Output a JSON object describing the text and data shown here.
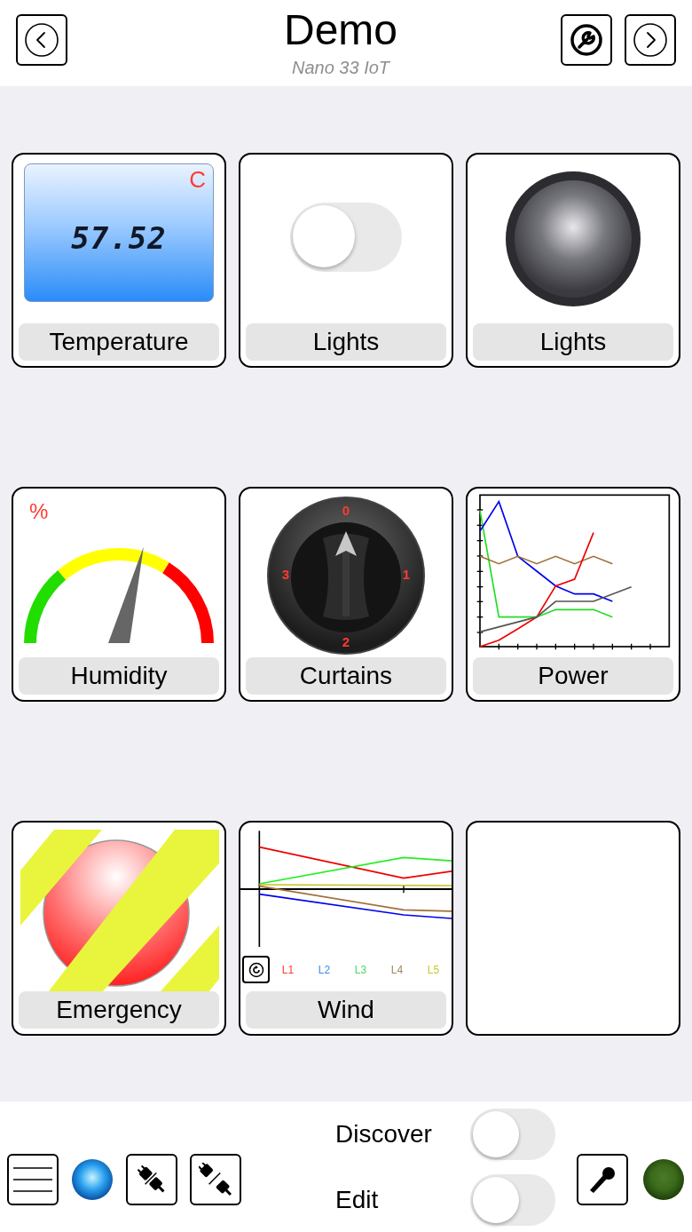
{
  "header": {
    "title": "Demo",
    "subtitle": "Nano 33 IoT"
  },
  "tiles": [
    {
      "kind": "temperature",
      "label": "Temperature",
      "value": "57.52",
      "unit": "C"
    },
    {
      "kind": "switch",
      "label": "Lights",
      "on": false
    },
    {
      "kind": "led",
      "label": "Lights",
      "on": false
    },
    {
      "kind": "gauge",
      "label": "Humidity",
      "unit": "%",
      "level": 0.58
    },
    {
      "kind": "knob",
      "label": "Curtains",
      "marks": [
        "0",
        "1",
        "2",
        "3"
      ]
    },
    {
      "kind": "plot",
      "label": "Power"
    },
    {
      "kind": "button",
      "label": "Emergency"
    },
    {
      "kind": "graph",
      "label": "Wind",
      "legend": [
        {
          "text": "L1",
          "color": "#ff3b30"
        },
        {
          "text": "L2",
          "color": "#3b8ee8"
        },
        {
          "text": "L3",
          "color": "#4cd964"
        },
        {
          "text": "L4",
          "color": "#a2845e"
        },
        {
          "text": "L5",
          "color": "#c7c72a"
        }
      ]
    },
    {
      "kind": "empty"
    }
  ],
  "toolbar": {
    "discover": {
      "label": "Discover",
      "on": false
    },
    "edit": {
      "label": "Edit",
      "on": false
    }
  }
}
